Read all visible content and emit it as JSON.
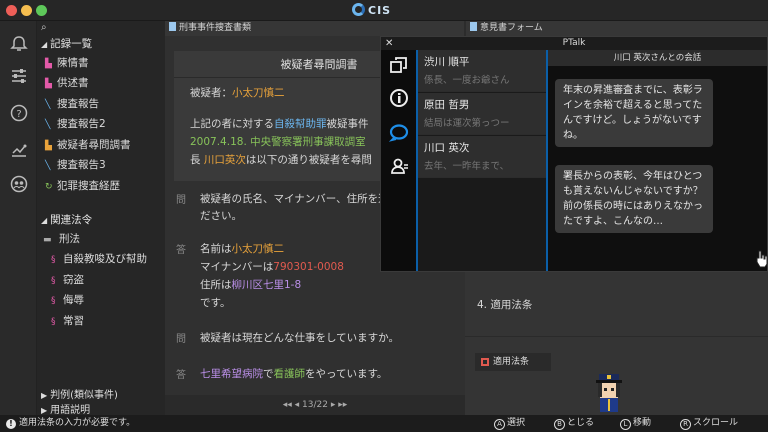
{
  "app": {
    "title": "CIS"
  },
  "left": {
    "records_header": "記録一覧",
    "records": [
      {
        "label": "陳情書",
        "icon": "doc-icon",
        "color": "#e35aa8"
      },
      {
        "label": "供述書",
        "icon": "doc-icon",
        "color": "#e35aa8"
      },
      {
        "label": "捜査報告",
        "icon": "wrench-icon",
        "color": "#6cb6ef"
      },
      {
        "label": "捜査報告2",
        "icon": "wrench-icon",
        "color": "#6cb6ef"
      },
      {
        "label": "被疑者尋問調書",
        "icon": "doc-icon",
        "color": "#e9a33b"
      },
      {
        "label": "捜査報告3",
        "icon": "wrench-icon",
        "color": "#6cb6ef"
      },
      {
        "label": "犯罪捜査経歴",
        "icon": "history-icon",
        "color": "#88c35a"
      }
    ],
    "laws_header": "関連法令",
    "laws_folder": "刑法",
    "laws": [
      "自殺教唆及び幇助",
      "窃盗",
      "侮辱",
      "常習"
    ],
    "precedents": "判例(類似事件)",
    "glossary": "用語説明"
  },
  "doc": {
    "tab": "刑事事件捜査書類",
    "title": "被疑者尋問調書",
    "suspect_label": "被疑者：",
    "suspect_name": "小太刀慎二",
    "intro1a": "上記の者に対する",
    "intro1b": "自殺幇助罪",
    "intro1c": "被疑事件",
    "intro2a": "2007.4.18. 中央警察署刑事課取調室",
    "intro3a": "長",
    "intro3b": "川口英次",
    "intro3c": "は以下の通り被疑者を尋問",
    "q1_mark": "問",
    "q1_line1": "被疑者の氏名、マイナンバー、住所を述べてく",
    "q1_line2": "ださい。",
    "a1_mark": "答",
    "a1_name_pre": "名前は",
    "a1_name": "小太刀慎二",
    "a1_num_pre": "マイナンバーは",
    "a1_num": "790301-0008",
    "a1_addr_pre": "住所は",
    "a1_addr": "柳川区七里1-8",
    "a1_end": "です。",
    "q2_mark": "問",
    "q2_line": "被疑者は現在どんな仕事をしていますか。",
    "a2_mark": "答",
    "a2_place": "七里希望病院",
    "a2_mid": "で",
    "a2_job": "看護師",
    "a2_end": "をやっています。",
    "pager": "◂◂ ◂ 13/22 ▸ ▸▸"
  },
  "form": {
    "tab": "意見書フォーム",
    "row4": "4. 適用法条",
    "law_button": "適用法条"
  },
  "ptalk": {
    "title": "PTalk",
    "close": "✕",
    "contacts": [
      {
        "name": "渋川 順平",
        "preview": "係長、一度お爺さん"
      },
      {
        "name": "原田 哲男",
        "preview": "結局は運次第っつー"
      },
      {
        "name": "川口 英次",
        "preview": "去年、一昨年まで、"
      }
    ],
    "chat_header": "川口 英次さんとの会話",
    "messages": [
      "年末の昇進審査までに、表彰ラインを余裕で超えると思ってたんですけど。しょうがないですね。",
      "署長からの表彰、今年はひとつも貰えないんじゃないですか？ 前の係長の時にはありえなかったですよ、こんなの…"
    ]
  },
  "status": {
    "message": "適用法条の入力が必要です。",
    "hints": [
      {
        "key": "A",
        "label": "選択"
      },
      {
        "key": "B",
        "label": "とじる"
      },
      {
        "key": "L",
        "label": "移動"
      },
      {
        "key": "R",
        "label": "スクロール"
      }
    ]
  }
}
